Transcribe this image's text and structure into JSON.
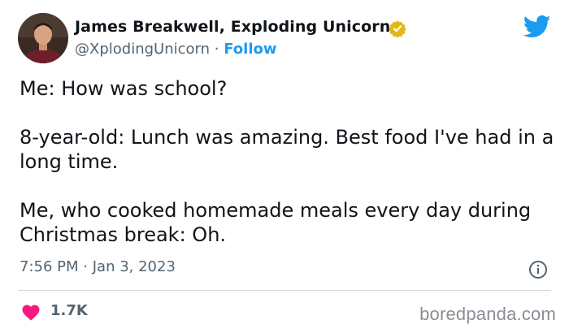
{
  "author": {
    "name": "James Breakwell, Exploding Unicorn",
    "handle": "@XplodingUnicorn",
    "separator": "·",
    "follow_label": "Follow",
    "verified_badge": "gold-verified-icon"
  },
  "tweet": {
    "paragraphs": [
      "Me: How was school?",
      "8-year-old: Lunch was amazing. Best food I've had in a long time.",
      "Me, who cooked homemade meals every day during Christmas break: Oh."
    ],
    "time": "7:56 PM",
    "date_separator": "·",
    "date": "Jan 3, 2023"
  },
  "engagement": {
    "likes": "1.7K",
    "like_icon": "heart-icon"
  },
  "icons": {
    "platform": "twitter-bird-icon",
    "info": "info-icon"
  },
  "watermark": {
    "text": "boredpanda.com"
  },
  "colors": {
    "accent": "#1d9bf0",
    "heart": "#f91880",
    "verified_gold": "#e2b719",
    "secondary_text": "#536471"
  }
}
